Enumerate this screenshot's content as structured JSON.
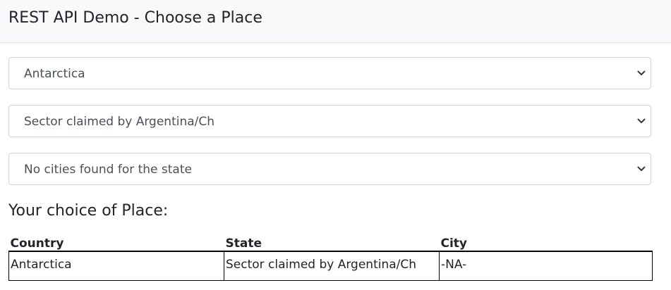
{
  "navbar": {
    "title": "REST API Demo - Choose a Place"
  },
  "selects": {
    "country": {
      "value": "Antarctica"
    },
    "state": {
      "value": "Sector claimed by Argentina/Ch"
    },
    "city": {
      "value": "No cities found for the state"
    }
  },
  "result": {
    "heading": "Your choice of Place:",
    "columns": [
      "Country",
      "State",
      "City"
    ],
    "row": [
      "Antarctica",
      "Sector claimed by Argentina/Ch",
      "-NA-"
    ]
  },
  "icons": {
    "dropdown": "chevron-down-icon"
  }
}
